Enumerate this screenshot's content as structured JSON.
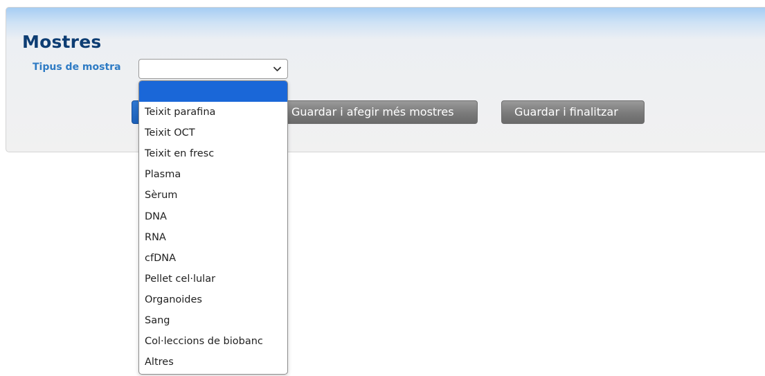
{
  "page": {
    "title": "Mostres"
  },
  "form": {
    "sample_type_label": "Tipus de mostra",
    "sample_type_value": "",
    "sample_type_options": [
      "",
      "Teixit parafina",
      "Teixit OCT",
      "Teixit en fresc",
      "Plasma",
      "Sèrum",
      "DNA",
      "RNA",
      "cfDNA",
      "Pellet cel·lular",
      "Organoides",
      "Sang",
      "Col·leccions de biobanc",
      "Altres"
    ]
  },
  "buttons": {
    "save_add_more_label": "Guardar i afegir més mostres",
    "save_finish_label": "Guardar i finalitzar"
  },
  "colors": {
    "title": "#0d3d73",
    "label": "#2e7bc4",
    "selected_option": "#1a67d8",
    "button_gray": "#7a7a7a",
    "button_blue": "#1b5fb8"
  },
  "icons": {
    "select_arrow": "chevron-down-icon"
  }
}
